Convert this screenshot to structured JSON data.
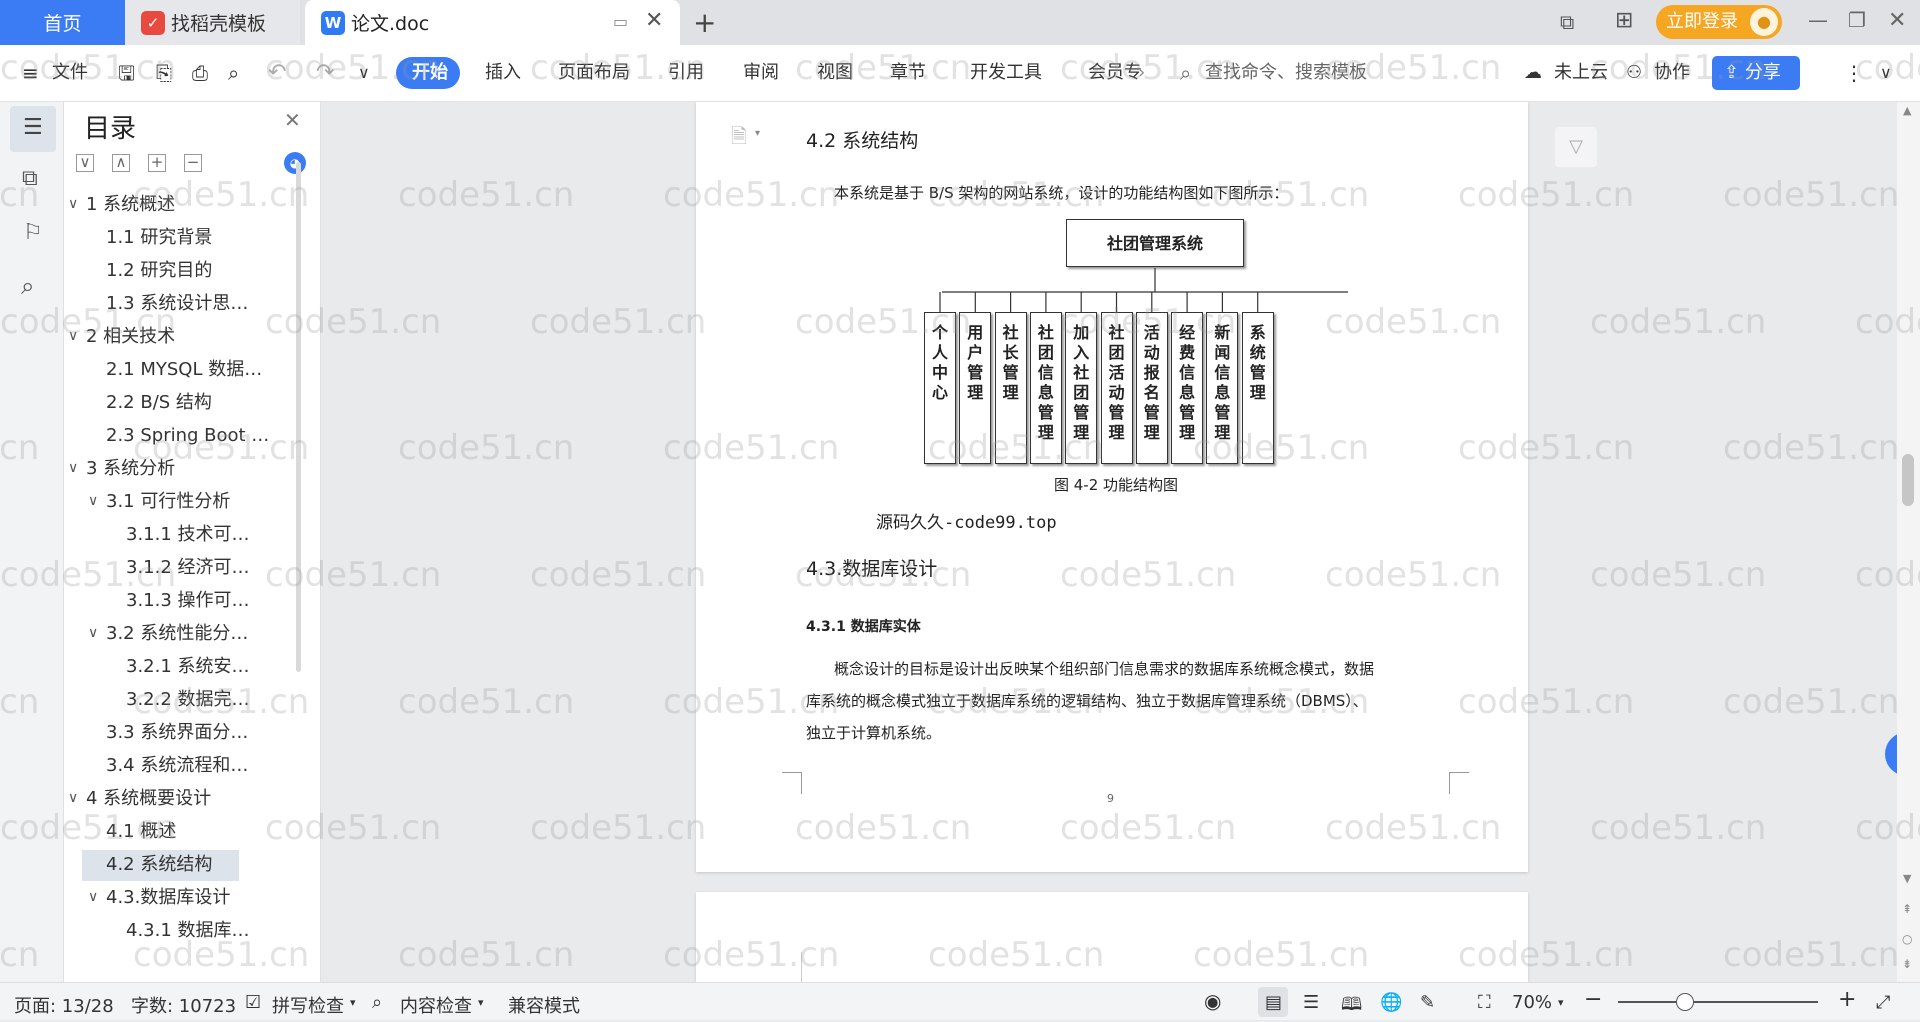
{
  "tabs": {
    "home": "首页",
    "templates": "找稻壳模板",
    "doc": "论文.doc",
    "login": "立即登录"
  },
  "toolbar": {
    "file": "文件",
    "menus": [
      "开始",
      "插入",
      "页面布局",
      "引用",
      "审阅",
      "视图",
      "章节",
      "开发工具",
      "会员专"
    ],
    "search_placeholder": "查找命令、搜索模板",
    "cloud": "未上云",
    "collab": "协作",
    "share": "分享"
  },
  "toc": {
    "title": "目录",
    "items": [
      {
        "label": "1 系统概述",
        "level": 1,
        "chev": "∨"
      },
      {
        "label": "1.1  研究背景",
        "level": 2
      },
      {
        "label": "1.2 研究目的",
        "level": 2
      },
      {
        "label": "1.3 系统设计思…",
        "level": 2
      },
      {
        "label": "2 相关技术",
        "level": 1,
        "chev": "∨"
      },
      {
        "label": "2.1 MYSQL 数据…",
        "level": 2
      },
      {
        "label": "2.2 B/S 结构",
        "level": 2
      },
      {
        "label": "2.3 Spring Boot …",
        "level": 2
      },
      {
        "label": "3 系统分析",
        "level": 1,
        "chev": "∨"
      },
      {
        "label": "3.1 可行性分析",
        "level": 2,
        "chev": "∨"
      },
      {
        "label": "3.1.1 技术可…",
        "level": 3
      },
      {
        "label": "3.1.2 经济可…",
        "level": 3
      },
      {
        "label": "3.1.3 操作可…",
        "level": 3
      },
      {
        "label": "3.2 系统性能分…",
        "level": 2,
        "chev": "∨"
      },
      {
        "label": "3.2.1  系统安…",
        "level": 3
      },
      {
        "label": "3.2.2  数据完…",
        "level": 3
      },
      {
        "label": "3.3 系统界面分…",
        "level": 2
      },
      {
        "label": "3.4 系统流程和…",
        "level": 2
      },
      {
        "label": "4 系统概要设计",
        "level": 1,
        "chev": "∨"
      },
      {
        "label": "4.1 概述",
        "level": 2
      },
      {
        "label": "4.2 系统结构",
        "level": 2,
        "selected": true
      },
      {
        "label": "4.3.数据库设计",
        "level": 2,
        "chev": "∨"
      },
      {
        "label": "4.3.1 数据库…",
        "level": 3
      }
    ]
  },
  "document": {
    "heading_42": "4.2 系统结构",
    "intro": "本系统是基于 B/S 架构的网站系统，设计的功能结构图如下图所示：",
    "root_node": "社团管理系统",
    "children": [
      "个人中心",
      "用户管理",
      "社长管理",
      "社团信息管理",
      "加入社团管理",
      "社团活动管理",
      "活动报名管理",
      "经费信息管理",
      "新闻信息管理",
      "系统管理"
    ],
    "caption": "图 4-2 功能结构图",
    "source_note": "源码久久-code99.top",
    "heading_43": "4.3.数据库设计",
    "heading_431": "4.3.1 数据库实体",
    "para_line1": "概念设计的目标是设计出反映某个组织部门信息需求的数据库系统概念模式，数据",
    "para_line2": "库系统的概念模式独立于数据库系统的逻辑结构、独立于数据库管理系统（DBMS）、",
    "para_line3": "独立于计算机系统。",
    "page_number": "9"
  },
  "watermark": "code51.cn",
  "status": {
    "page": "页面: 13/28",
    "words": "字数: 10723",
    "spell": "拼写检查",
    "content_check": "内容检查",
    "compat": "兼容模式",
    "zoom": "70%"
  }
}
